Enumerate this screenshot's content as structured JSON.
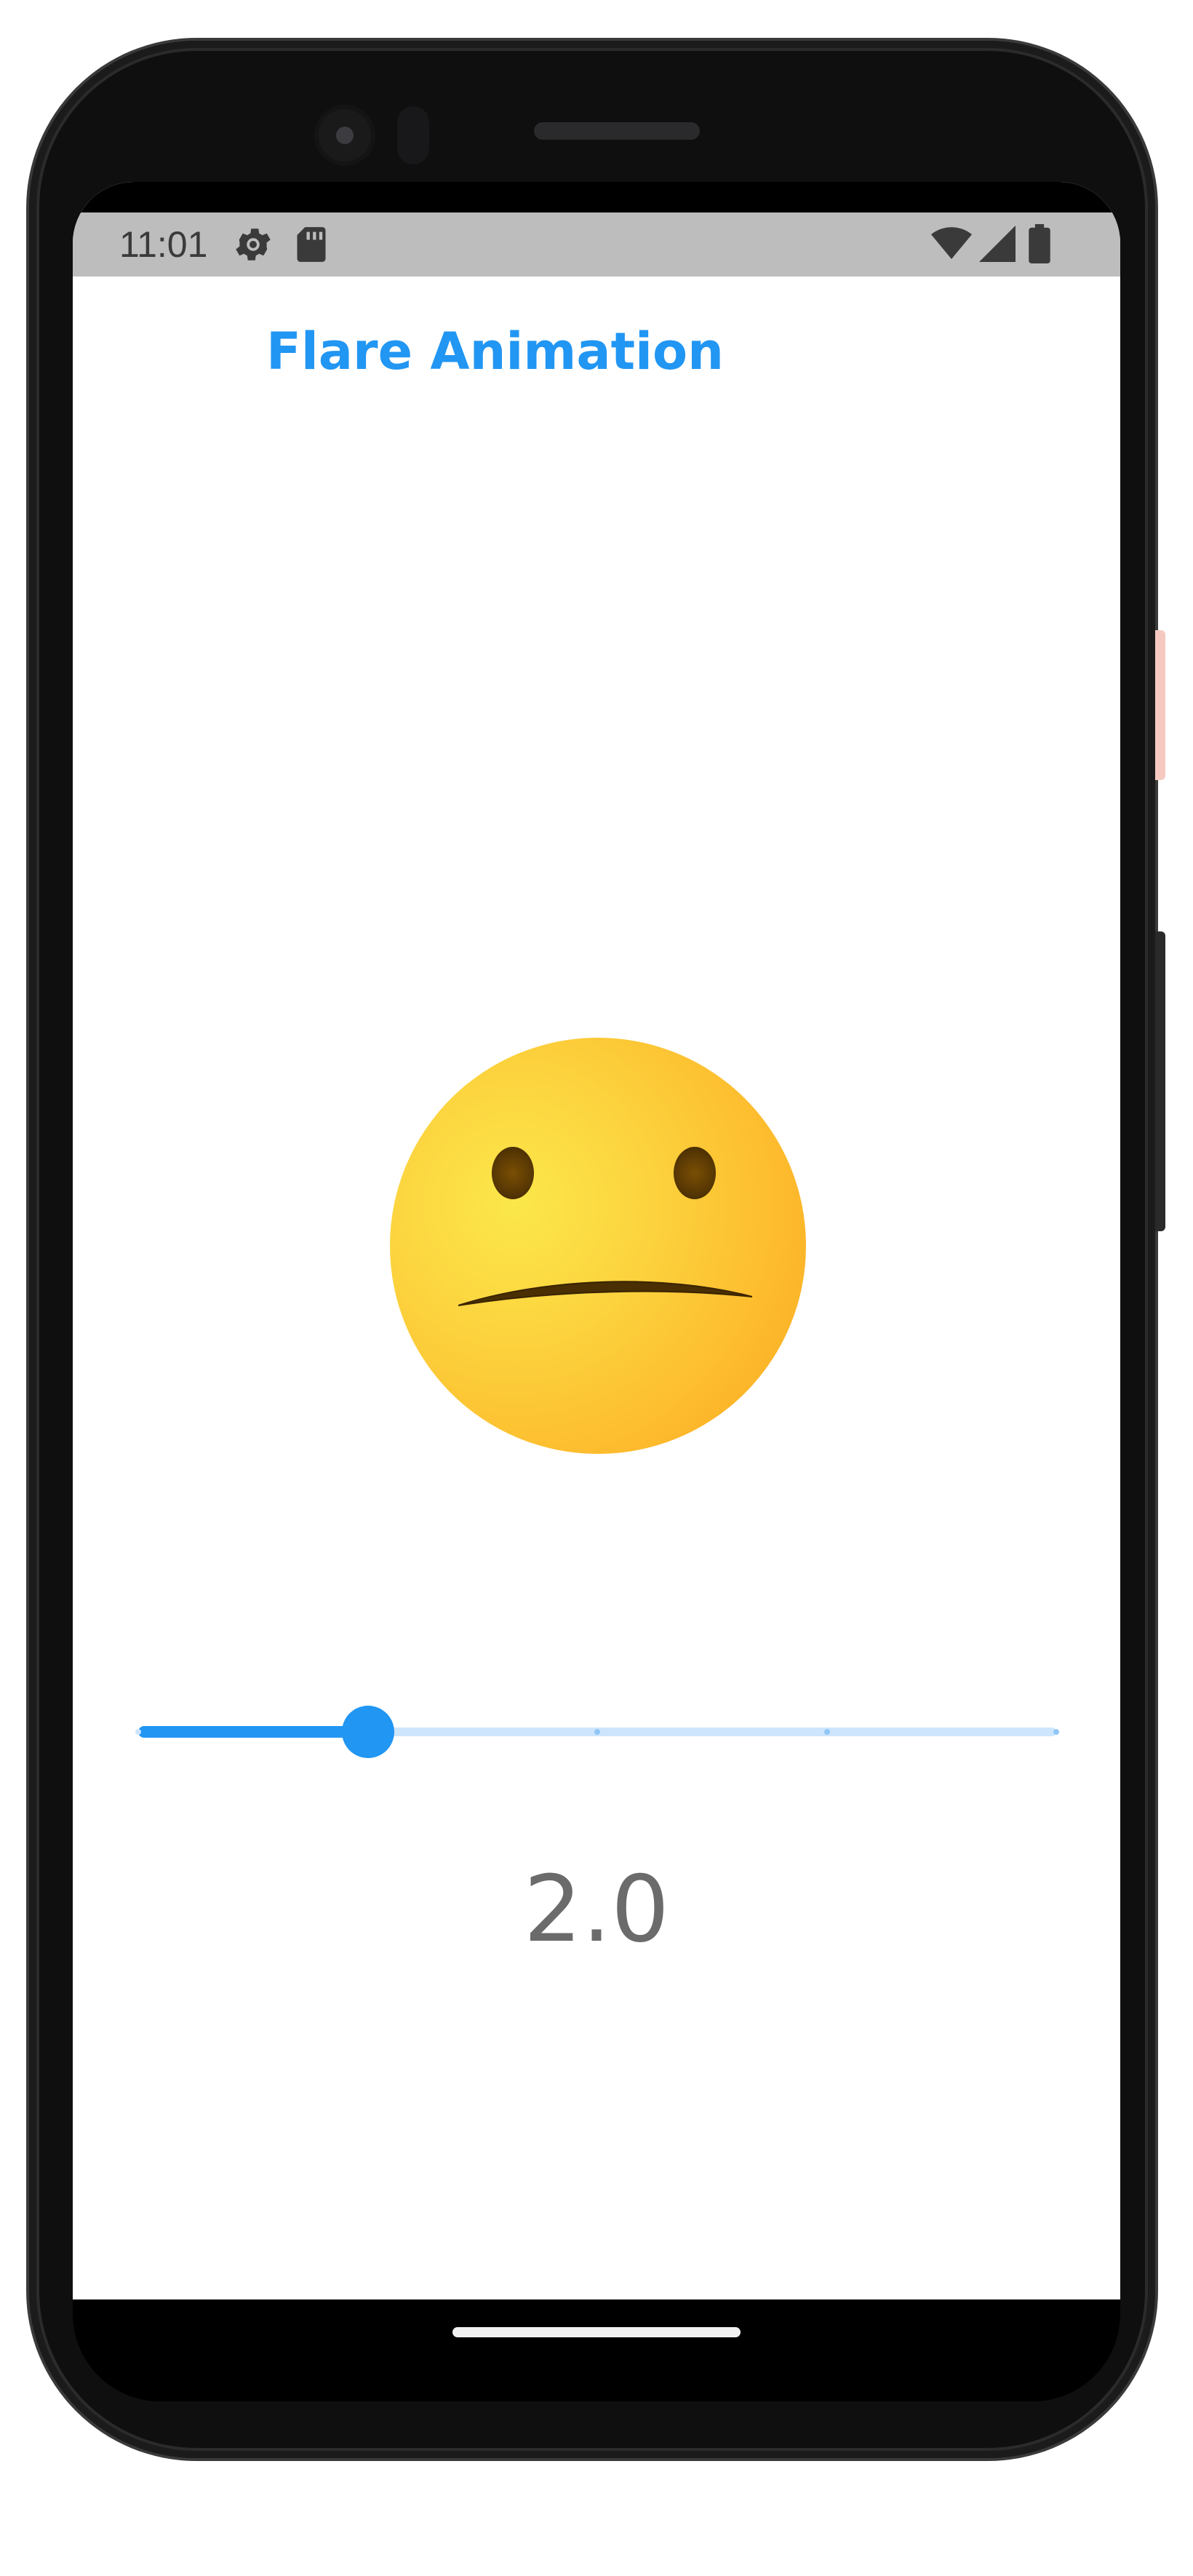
{
  "status_bar": {
    "time": "11:01",
    "icons": [
      "gear-icon",
      "sd-card-icon",
      "wifi-icon",
      "cell-signal-icon",
      "battery-icon"
    ]
  },
  "app": {
    "title": "Flare Animation",
    "accent_color": "#2196f3"
  },
  "emoji": {
    "name": "neutral-face",
    "face_color": "#fdbb2d",
    "feature_color": "#5a3903"
  },
  "slider": {
    "min": 0,
    "max": 4,
    "divisions": 4,
    "value": 1,
    "value_label": "2.0",
    "active_color": "#2196f3",
    "inactive_color": "#cde6fd"
  }
}
